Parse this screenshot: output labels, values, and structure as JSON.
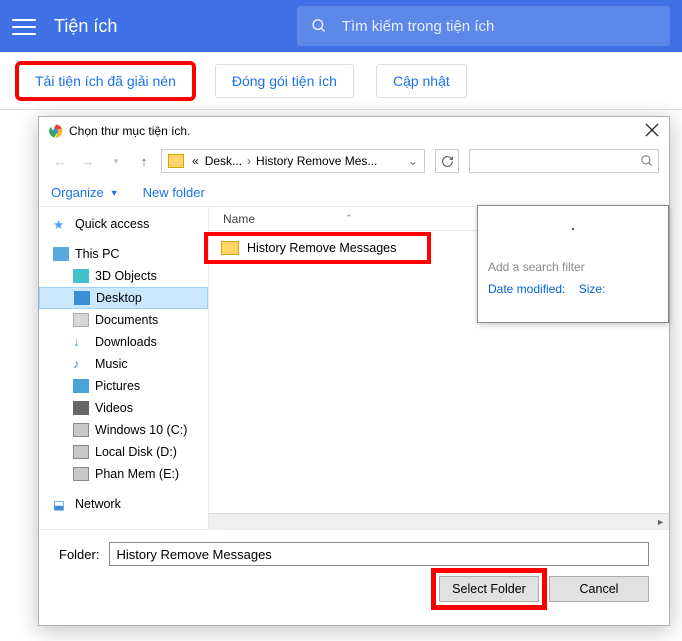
{
  "ext_header": {
    "title": "Tiện ích",
    "search_placeholder": "Tìm kiếm trong tiện ích"
  },
  "ext_toolbar": {
    "load_unpacked": "Tải tiện ích đã giải nén",
    "pack": "Đóng gói tiện ích",
    "update": "Cập nhật"
  },
  "dialog": {
    "title": "Chọn thư mục tiện ích.",
    "breadcrumb": {
      "prefix": "«",
      "first": "Desk...",
      "second": "History Remove Mes..."
    },
    "toolbar": {
      "organize": "Organize",
      "new_folder": "New folder"
    },
    "column_header": "Name",
    "tree": {
      "quick_access": "Quick access",
      "this_pc": "This PC",
      "d3": "3D Objects",
      "desktop": "Desktop",
      "documents": "Documents",
      "downloads": "Downloads",
      "music": "Music",
      "pictures": "Pictures",
      "videos": "Videos",
      "win10": "Windows 10 (C:)",
      "local_d": "Local Disk (D:)",
      "phan_mem": "Phan Mem (E:)",
      "network": "Network"
    },
    "item": "History Remove Messages",
    "search_popup": {
      "hint": "Add a search filter",
      "date": "Date modified:",
      "size": "Size:"
    },
    "folder_label": "Folder:",
    "folder_value": "History Remove Messages",
    "select_btn": "Select Folder",
    "cancel_btn": "Cancel"
  }
}
